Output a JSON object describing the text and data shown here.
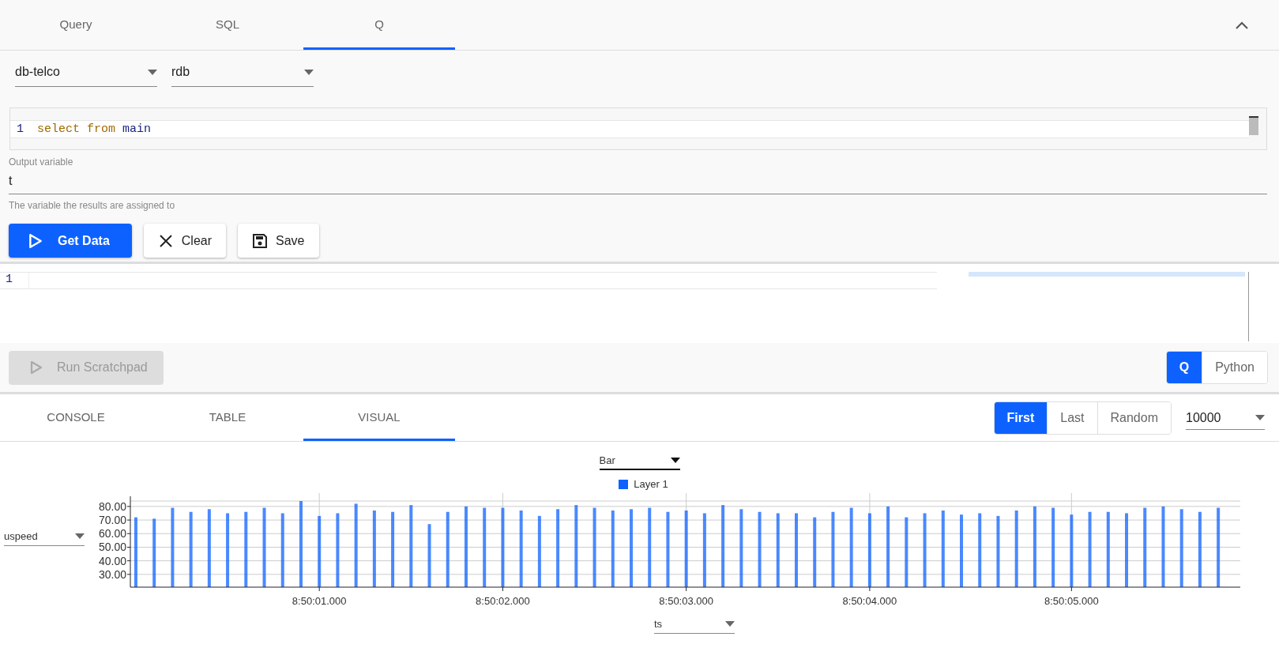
{
  "query_tabs": [
    {
      "label": "Query",
      "selected": false
    },
    {
      "label": "SQL",
      "selected": false
    },
    {
      "label": "Q",
      "selected": true
    }
  ],
  "selectors": [
    {
      "value": "db-telco"
    },
    {
      "value": "rdb"
    }
  ],
  "query_editor": {
    "line_number": "1",
    "tokens": [
      {
        "text": "select",
        "kind": "keyword"
      },
      {
        "text": "from",
        "kind": "keyword"
      },
      {
        "text": "main",
        "kind": "name"
      }
    ]
  },
  "output_variable": {
    "label": "Output variable",
    "value": "t",
    "helper": "The variable the results are assigned to"
  },
  "actions": [
    {
      "label": "Get Data",
      "kind": "primary"
    },
    {
      "label": "Clear",
      "kind": "clear"
    },
    {
      "label": "Save",
      "kind": "save"
    }
  ],
  "scratchpad": {
    "line_number": "1",
    "run_label": "Run Scratchpad",
    "run_disabled": true
  },
  "languages": [
    {
      "label": "Q",
      "selected": true
    },
    {
      "label": "Python",
      "selected": false
    }
  ],
  "result_tabs": [
    {
      "label": "CONSOLE",
      "selected": false
    },
    {
      "label": "TABLE",
      "selected": false
    },
    {
      "label": "VISUAL",
      "selected": true
    }
  ],
  "sampling": [
    {
      "label": "First",
      "selected": true
    },
    {
      "label": "Last",
      "selected": false
    },
    {
      "label": "Random",
      "selected": false
    }
  ],
  "row_limit": "10000",
  "visual": {
    "chart_type": "Bar",
    "y_field": "uspeed",
    "x_field": "ts",
    "chart_data": {
      "type": "bar",
      "grid": true,
      "ylim": [
        20.6,
        84
      ],
      "yticks": [
        {
          "value": 30,
          "label": "30.00"
        },
        {
          "value": 40,
          "label": "40.00"
        },
        {
          "value": 50,
          "label": "50.00"
        },
        {
          "value": 60,
          "label": "60.00"
        },
        {
          "value": 70,
          "label": "70.00"
        },
        {
          "value": 80,
          "label": "80.00"
        }
      ],
      "categories": [
        null,
        null,
        null,
        null,
        null,
        null,
        null,
        null,
        null,
        null,
        "8:50:01.000",
        null,
        null,
        null,
        null,
        null,
        null,
        null,
        null,
        null,
        "8:50:02.000",
        null,
        null,
        null,
        null,
        null,
        null,
        null,
        null,
        null,
        "8:50:03.000",
        null,
        null,
        null,
        null,
        null,
        null,
        null,
        null,
        null,
        "8:50:04.000",
        null,
        null,
        null,
        null,
        null,
        null,
        null,
        null,
        null,
        null,
        "8:50:05.000",
        null,
        null,
        null,
        null,
        null,
        null,
        null,
        null
      ],
      "series": [
        {
          "name": "Layer 1",
          "color": "#0d62ff",
          "values": [
            72,
            71,
            79,
            76,
            78,
            75,
            76,
            79,
            75,
            84,
            73,
            75,
            82,
            77,
            76,
            81,
            67,
            76,
            80,
            79,
            79,
            77,
            73,
            78,
            81,
            79,
            77,
            78,
            79,
            76,
            77,
            75,
            81,
            78,
            76,
            75,
            75,
            72,
            76,
            79,
            75,
            80,
            72,
            75,
            77,
            74,
            75,
            73,
            77,
            80,
            79,
            74,
            76,
            76,
            75,
            79,
            80,
            78,
            76,
            79
          ]
        }
      ]
    }
  }
}
